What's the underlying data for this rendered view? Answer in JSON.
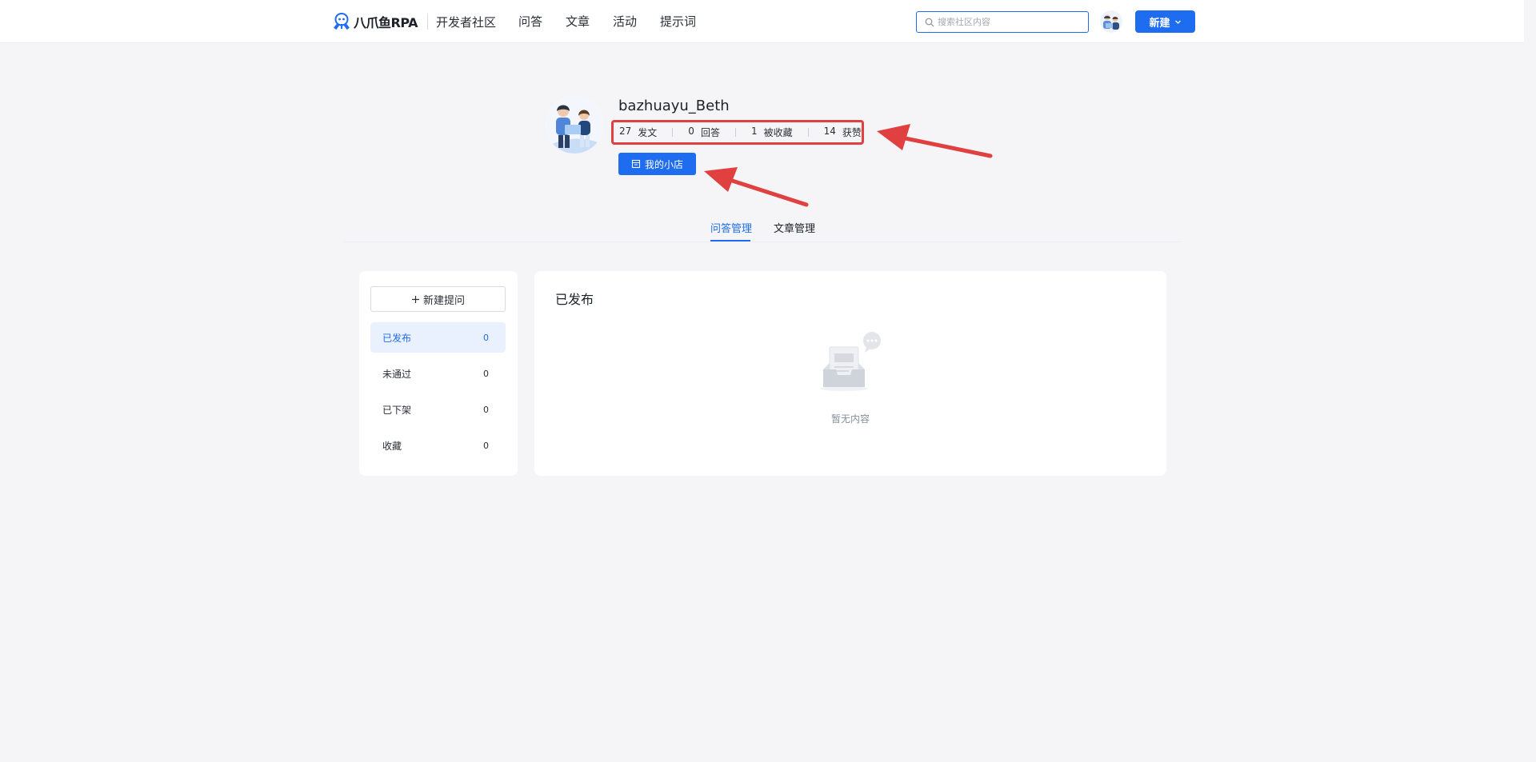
{
  "header": {
    "logo_text": "八爪鱼RPA",
    "logo_subtitle": "开发者社区",
    "nav": [
      {
        "label": "问答"
      },
      {
        "label": "文章"
      },
      {
        "label": "活动"
      },
      {
        "label": "提示词"
      }
    ],
    "search_placeholder": "搜索社区内容",
    "new_button_label": "新建"
  },
  "profile": {
    "username": "bazhuayu_Beth",
    "stats": [
      {
        "value": "27",
        "label": "发文"
      },
      {
        "value": "0",
        "label": "回答"
      },
      {
        "value": "1",
        "label": "被收藏"
      },
      {
        "value": "14",
        "label": "获赞"
      }
    ],
    "shop_button_label": "我的小店"
  },
  "tabs": [
    {
      "label": "问答管理",
      "active": true
    },
    {
      "label": "文章管理",
      "active": false
    }
  ],
  "sidebar": {
    "new_question_label": "新建提问",
    "items": [
      {
        "label": "已发布",
        "count": "0",
        "active": true
      },
      {
        "label": "未通过",
        "count": "0",
        "active": false
      },
      {
        "label": "已下架",
        "count": "0",
        "active": false
      },
      {
        "label": "收藏",
        "count": "0",
        "active": false
      }
    ]
  },
  "main": {
    "title": "已发布",
    "empty_text": "暂无内容"
  },
  "colors": {
    "primary": "#1e6df0",
    "highlight_annotation": "#e0403f",
    "background": "#f5f5f7"
  }
}
